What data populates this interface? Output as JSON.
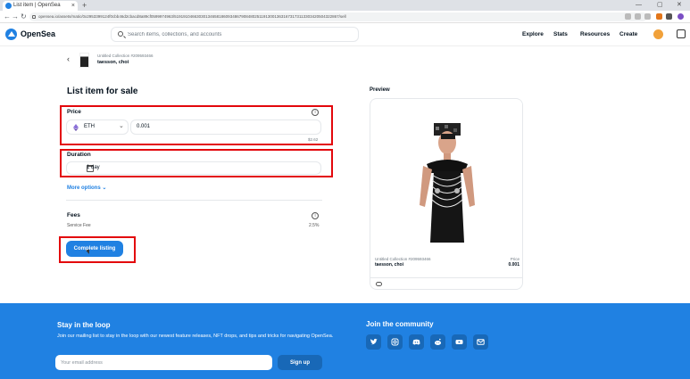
{
  "browser": {
    "tab_title": "List item | OpenSea",
    "tab_close": "×",
    "new_tab": "+",
    "url": "opensea.io/assets/matic/0x2953399124f0cbb46d2cbacd8a89cf0599974963/51919104663030134658186093486790848025119130013631673173113303420504322867/sell",
    "nav": {
      "back": "←",
      "forward": "→",
      "reload": "↻"
    },
    "window": {
      "minimize": "—",
      "maximize": "▢",
      "close": "✕"
    }
  },
  "header": {
    "logo_text": "OpenSea",
    "search_placeholder": "Search items, collections, and accounts",
    "nav": [
      "Explore",
      "Stats",
      "Resources",
      "Create"
    ]
  },
  "item": {
    "back_arrow": "‹",
    "collection": "Untitled Collection #209593466",
    "owner": "taesson, choi"
  },
  "form": {
    "title": "List item for sale",
    "price_label": "Price",
    "info_glyph": "i",
    "currency": "ETH",
    "currency_chevron": "⌄",
    "price_value": "0.001",
    "usd_value": "$2.62",
    "duration_label": "Duration",
    "duration_value": "1 day",
    "more_options": "More options ⌄",
    "fees_label": "Fees",
    "service_fee_label": "Service Fee",
    "service_fee_value": "2.5%",
    "submit": "Complete listing"
  },
  "preview": {
    "label": "Preview",
    "collection": "Untitled Collection #209593466",
    "owner": "taesson, choi",
    "price_label": "Price",
    "price": "0.001"
  },
  "footer": {
    "stay_title": "Stay in the loop",
    "stay_text": "Join our mailing list to stay in the loop with our newest feature releases, NFT drops, and tips and tricks for navigating OpenSea.",
    "email_placeholder": "Your email address",
    "signup": "Sign up",
    "community_title": "Join the community"
  },
  "colors": {
    "brand": "#2081e2",
    "highlight": "#e3070c"
  }
}
